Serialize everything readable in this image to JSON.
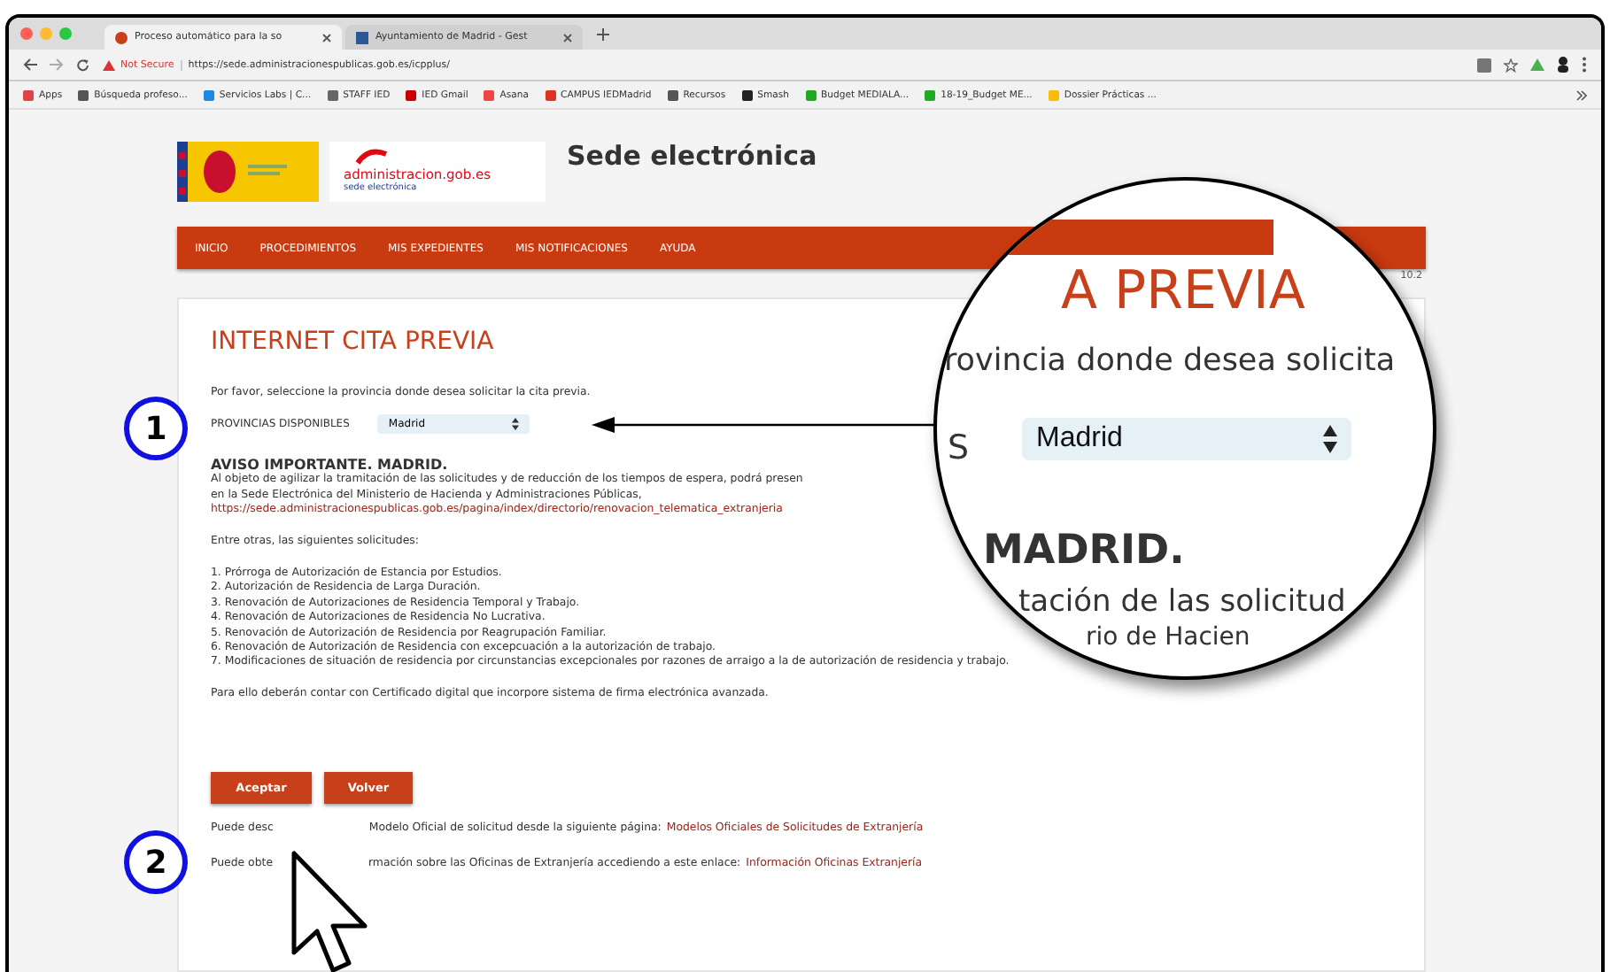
{
  "browser": {
    "tabs": [
      {
        "title": "Proceso automático para la so",
        "selected": true
      },
      {
        "title": "Ayuntamiento de Madrid - Gest",
        "selected": false
      }
    ],
    "security": "Not Secure",
    "url": "https://sede.administracionespublicas.gob.es/icpplus/",
    "bookmarks": [
      "Apps",
      "Búsqueda profeso...",
      "Servicios Labs | C...",
      "STAFF IED",
      "IED Gmail",
      "Asana",
      "CAMPUS IEDMadrid",
      "Recursos",
      "Smash",
      "Budget MEDIALA...",
      "18-19_Budget ME...",
      "Dossier Prácticas ..."
    ]
  },
  "site": {
    "logo_text": "administracion.gob.es",
    "logo_subtext": "sede electrónica",
    "title": "Sede electrónica",
    "nav": [
      "INICIO",
      "PROCEDIMIENTOS",
      "MIS EXPEDIENTES",
      "MIS NOTIFICACIONES",
      "AYUDA"
    ],
    "version": "10.2"
  },
  "form": {
    "heading": "INTERNET CITA PREVIA",
    "instruction": "Por favor, seleccione la provincia donde desea solicitar la cita previa.",
    "province_label": "PROVINCIAS DISPONIBLES",
    "province_value": "Madrid",
    "notice_title": "AVISO IMPORTANTE. MADRID.",
    "notice_lines": [
      "Al objeto de agilizar la tramitación de las solicitudes y de reducción de los tiempos de espera, podrá presen",
      "en la Sede Electrónica del Ministerio de Hacienda y Administraciones Públicas,"
    ],
    "notice_link": "https://sede.administracionespublicas.gob.es/pagina/index/directorio/renovacion_telematica_extranjeria",
    "list_intro": "Entre otras, las siguientes solicitudes:",
    "list": [
      "1. Prórroga de Autorización de Estancia por Estudios.",
      "2. Autorización de Residencia de Larga Duración.",
      "3. Renovación de Autorizaciones de Residencia Temporal y Trabajo.",
      "4. Renovación de Autorizaciones de Residencia No Lucrativa.",
      "5. Renovación de Autorización de Residencia por Reagrupación Familiar.",
      "6. Renovación de Autorización de Residencia con excepcuación a la autorización de trabajo.",
      "7. Modificaciones de situación de residencia por circunstancias excepcionales por razones de arraigo a la de autorización de residencia y trabajo."
    ],
    "closing": "Para ello deberán contar con Certificado digital que incorpore sistema de firma electrónica avanzada.",
    "buttons": [
      "Aceptar",
      "Volver"
    ],
    "footer_lines": [
      {
        "before": "Puede desc",
        "after": "Modelo Oficial de solicitud desde la siguiente página:",
        "link": "Modelos Oficiales de Solicitudes de Extranjería"
      },
      {
        "before": "Puede obte",
        "after": "rmación sobre las Oficinas de Extranjería accediendo a este enlace:",
        "link": "Información Oficinas Extranjería"
      }
    ]
  },
  "magnifier": {
    "heading": "A PREVIA",
    "instruction": "rovincia donde desea solicita",
    "label": "S",
    "value": "Madrid",
    "notice_title": "MADRID.",
    "lines": [
      "tación de las solicitud",
      "rio de Hacien"
    ]
  },
  "callouts": [
    "1",
    "2"
  ]
}
